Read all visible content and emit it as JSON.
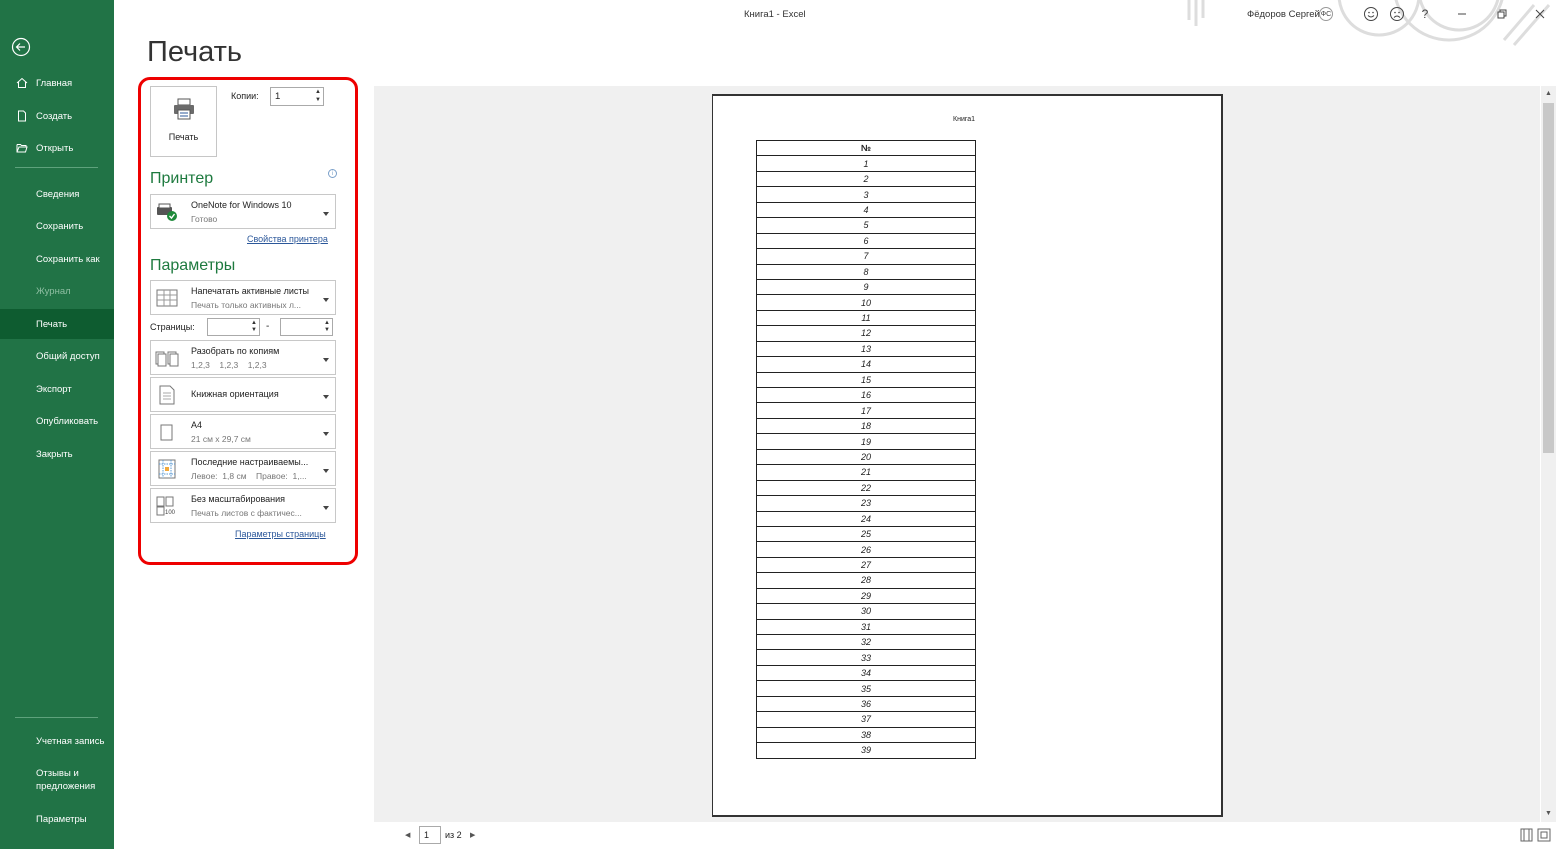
{
  "window": {
    "title": "Книга1  -  Excel",
    "user": "Фёдоров Сергей",
    "user_initials": "ФС",
    "help": "?"
  },
  "sidebar": {
    "items": [
      {
        "label": "Главная",
        "icon": "home-icon"
      },
      {
        "label": "Создать",
        "icon": "new-file-icon"
      },
      {
        "label": "Открыть",
        "icon": "folder-open-icon"
      },
      {
        "label": "Сведения"
      },
      {
        "label": "Сохранить"
      },
      {
        "label": "Сохранить как"
      },
      {
        "label": "Журнал",
        "disabled": true
      },
      {
        "label": "Печать",
        "active": true
      },
      {
        "label": "Общий доступ"
      },
      {
        "label": "Экспорт"
      },
      {
        "label": "Опубликовать"
      },
      {
        "label": "Закрыть"
      }
    ],
    "bottom": [
      {
        "label": "Учетная запись"
      },
      {
        "label": "Отзывы и предложения"
      },
      {
        "label": "Параметры"
      }
    ]
  },
  "print": {
    "heading": "Печать",
    "print_button_label": "Печать",
    "copies_label": "Копии:",
    "copies_value": "1",
    "printer_section": "Принтер",
    "printer_name": "OneNote for Windows 10",
    "printer_status": "Готово",
    "printer_properties_link": "Свойства принтера",
    "params_section": "Параметры",
    "what_to_print": {
      "title": "Напечатать активные листы",
      "sub": "Печать только активных л..."
    },
    "pages_label": "Страницы:",
    "pages_dash": "-",
    "collate": {
      "title": "Разобрать по копиям",
      "sub": "1,2,3    1,2,3    1,2,3"
    },
    "orientation": {
      "title": "Книжная ориентация"
    },
    "paper": {
      "title": "A4",
      "sub": "21 см x 29,7 см"
    },
    "margins": {
      "title": "Последние настраиваемы...",
      "sub": "Левое:  1,8 см    Правое:  1,..."
    },
    "scaling": {
      "title": "Без масштабирования",
      "sub": "Печать листов с фактичес..."
    },
    "page_setup_link": "Параметры страницы"
  },
  "preview": {
    "header_text": "Книга1",
    "column_header": "№",
    "rows": [
      "1",
      "2",
      "3",
      "4",
      "5",
      "6",
      "7",
      "8",
      "9",
      "10",
      "11",
      "12",
      "13",
      "14",
      "15",
      "16",
      "17",
      "18",
      "19",
      "20",
      "21",
      "22",
      "23",
      "24",
      "25",
      "26",
      "27",
      "28",
      "29",
      "30",
      "31",
      "32",
      "33",
      "34",
      "35",
      "36",
      "37",
      "38",
      "39"
    ],
    "current_page": "1",
    "page_of": "из 2"
  },
  "colors": {
    "sidebar": "#217346",
    "accent": "#1e7a3f",
    "highlight": "#e00000"
  }
}
